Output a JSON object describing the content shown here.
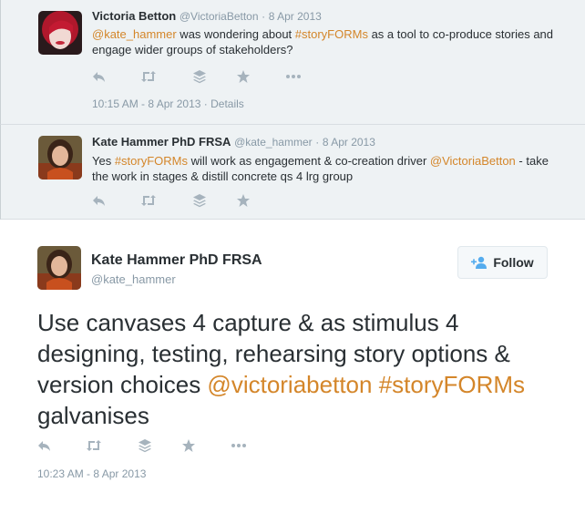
{
  "tweets": [
    {
      "fullname": "Victoria Betton",
      "handle": "@VictoriaBetton",
      "sep": "·",
      "date": "8 Apr 2013",
      "text_parts": [
        {
          "text": "@kate_hammer",
          "link": true
        },
        {
          "text": " was wondering about ",
          "link": false
        },
        {
          "text": "#storyFORMs",
          "link": true
        },
        {
          "text": " as a tool to co-produce stories and engage wider groups of stakeholders?",
          "link": false
        }
      ],
      "meta_time": "10:15 AM - 8 Apr 2013",
      "meta_sep": "·",
      "meta_details": "Details"
    },
    {
      "fullname": "Kate Hammer PhD FRSA",
      "handle": "@kate_hammer",
      "sep": "·",
      "date": "8 Apr 2013",
      "text_parts": [
        {
          "text": "Yes ",
          "link": false
        },
        {
          "text": "#storyFORMs",
          "link": true
        },
        {
          "text": " will work as engagement & co-creation driver ",
          "link": false
        },
        {
          "text": "@VictoriaBetton",
          "link": true
        },
        {
          "text": " - take the work in stages & distill concrete qs 4 lrg group",
          "link": false
        }
      ]
    }
  ],
  "main_tweet": {
    "fullname": "Kate Hammer PhD FRSA",
    "handle": "@kate_hammer",
    "follow_label": "Follow",
    "text_parts": [
      {
        "text": "Use canvases 4 capture & as stimulus 4 designing, testing, rehearsing story options & version choices ",
        "link": false
      },
      {
        "text": "@victoriabetton",
        "link": true
      },
      {
        "text": " ",
        "link": false
      },
      {
        "text": "#storyFORMs",
        "link": true
      },
      {
        "text": " galvanises",
        "link": false
      }
    ],
    "meta_time": "10:23 AM - 8 Apr 2013"
  },
  "icons": {
    "reply": "reply-icon",
    "retweet": "retweet-icon",
    "buffer": "buffer-icon",
    "favorite": "favorite-icon",
    "more": "more-icon",
    "follow": "add-user-icon"
  },
  "colors": {
    "link": "#d4862a",
    "muted": "#8899a6",
    "action_icon": "#a6b3bd",
    "convo_bg": "#eef2f4"
  }
}
